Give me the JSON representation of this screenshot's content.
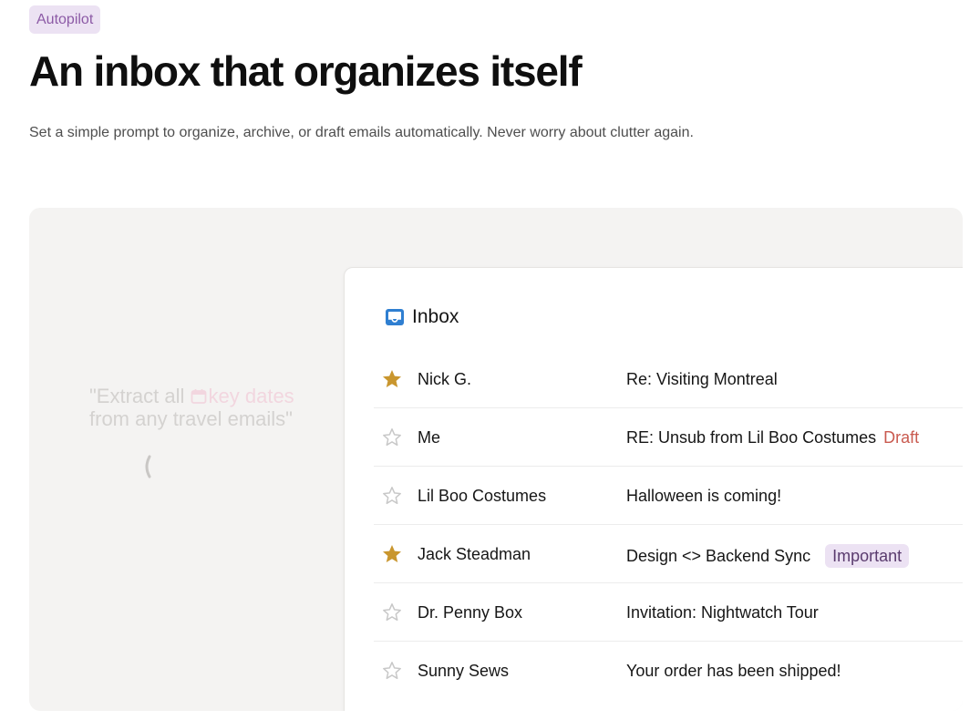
{
  "hero": {
    "badge": "Autopilot",
    "headline": "An inbox that organizes itself",
    "subtext": "Set a simple prompt to organize, archive, or draft emails automatically. Never worry about clutter again."
  },
  "prompt": {
    "line1_prefix": "\"Extract all ",
    "key_phrase": "key dates",
    "line2": "from any travel emails\"",
    "icon": "calendar-icon"
  },
  "inbox": {
    "title": "Inbox",
    "icon": "inbox-tray-icon",
    "colors": {
      "starred": "#c9962e",
      "unstarred": "#c8c8c8",
      "draft": "#c95a4f",
      "important_bg": "#ece2f3",
      "inbox_icon": "#2f7fd1"
    },
    "emails": [
      {
        "sender": "Nick G.",
        "subject": "Re: Visiting Montreal",
        "starred": true,
        "tag": null
      },
      {
        "sender": "Me",
        "subject": "RE: Unsub from Lil Boo Costumes",
        "starred": false,
        "tag": "Draft"
      },
      {
        "sender": "Lil Boo Costumes",
        "subject": "Halloween is coming!",
        "starred": false,
        "tag": null
      },
      {
        "sender": "Jack Steadman",
        "subject": "Design <> Backend Sync",
        "starred": true,
        "tag": "Important"
      },
      {
        "sender": "Dr. Penny Box",
        "subject": "Invitation: Nightwatch Tour",
        "starred": false,
        "tag": null
      },
      {
        "sender": "Sunny Sews",
        "subject": "Your order has been shipped!",
        "starred": false,
        "tag": null
      }
    ]
  }
}
